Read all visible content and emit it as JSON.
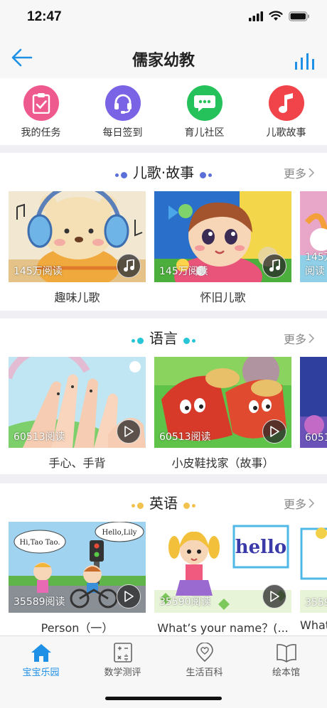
{
  "status": {
    "time": "12:47"
  },
  "nav": {
    "title": "儒家幼教"
  },
  "quick_menu": [
    {
      "label": "我的任务",
      "icon": "clipboard-check-icon",
      "color": "#ef5a8e"
    },
    {
      "label": "每日签到",
      "icon": "headset-icon",
      "color": "#7b63e6"
    },
    {
      "label": "育儿社区",
      "icon": "chat-bubbles-icon",
      "color": "#25c25b"
    },
    {
      "label": "儿歌故事",
      "icon": "music-note-icon",
      "color": "#f0434a"
    }
  ],
  "sections": [
    {
      "title": "儿歌·故事",
      "more": "更多",
      "dot_color": "#5b6fd8",
      "cards": [
        {
          "views": "145万阅读",
          "title": "趣味儿歌",
          "media": "music-note-icon"
        },
        {
          "views": "145万阅读",
          "title": "怀旧儿歌",
          "media": "music-note-icon"
        },
        {
          "views": "145万阅读",
          "title": "",
          "media": ""
        }
      ]
    },
    {
      "title": "语言",
      "more": "更多",
      "dot_color": "#27c6d6",
      "cards": [
        {
          "views": "60513阅读",
          "title": "手心、手背",
          "media": "play-icon"
        },
        {
          "views": "60513阅读",
          "title": "小皮鞋找家（故事）",
          "media": "play-icon"
        },
        {
          "views": "6051",
          "title": "",
          "media": ""
        }
      ]
    },
    {
      "title": "英语",
      "more": "更多",
      "dot_color": "#f2c24f",
      "cards": [
        {
          "views": "35589阅读",
          "title": "Person（一）",
          "media": "play-icon",
          "signs": [
            "Hi,Tao Tao.",
            "Hello,Lily"
          ]
        },
        {
          "views": "35590阅读",
          "title": "What’s your name？(...",
          "media": "play-icon",
          "board": "hello"
        },
        {
          "views": "3559",
          "title": "What",
          "media": ""
        }
      ]
    }
  ],
  "tabbar": [
    {
      "label": "宝宝乐园",
      "icon": "home-icon",
      "active": true
    },
    {
      "label": "数学测评",
      "icon": "calculator-icon",
      "active": false
    },
    {
      "label": "生活百科",
      "icon": "location-pin-icon",
      "active": false
    },
    {
      "label": "绘本馆",
      "icon": "open-book-icon",
      "active": false
    }
  ],
  "colors": {
    "accent": "#1e90e6"
  }
}
